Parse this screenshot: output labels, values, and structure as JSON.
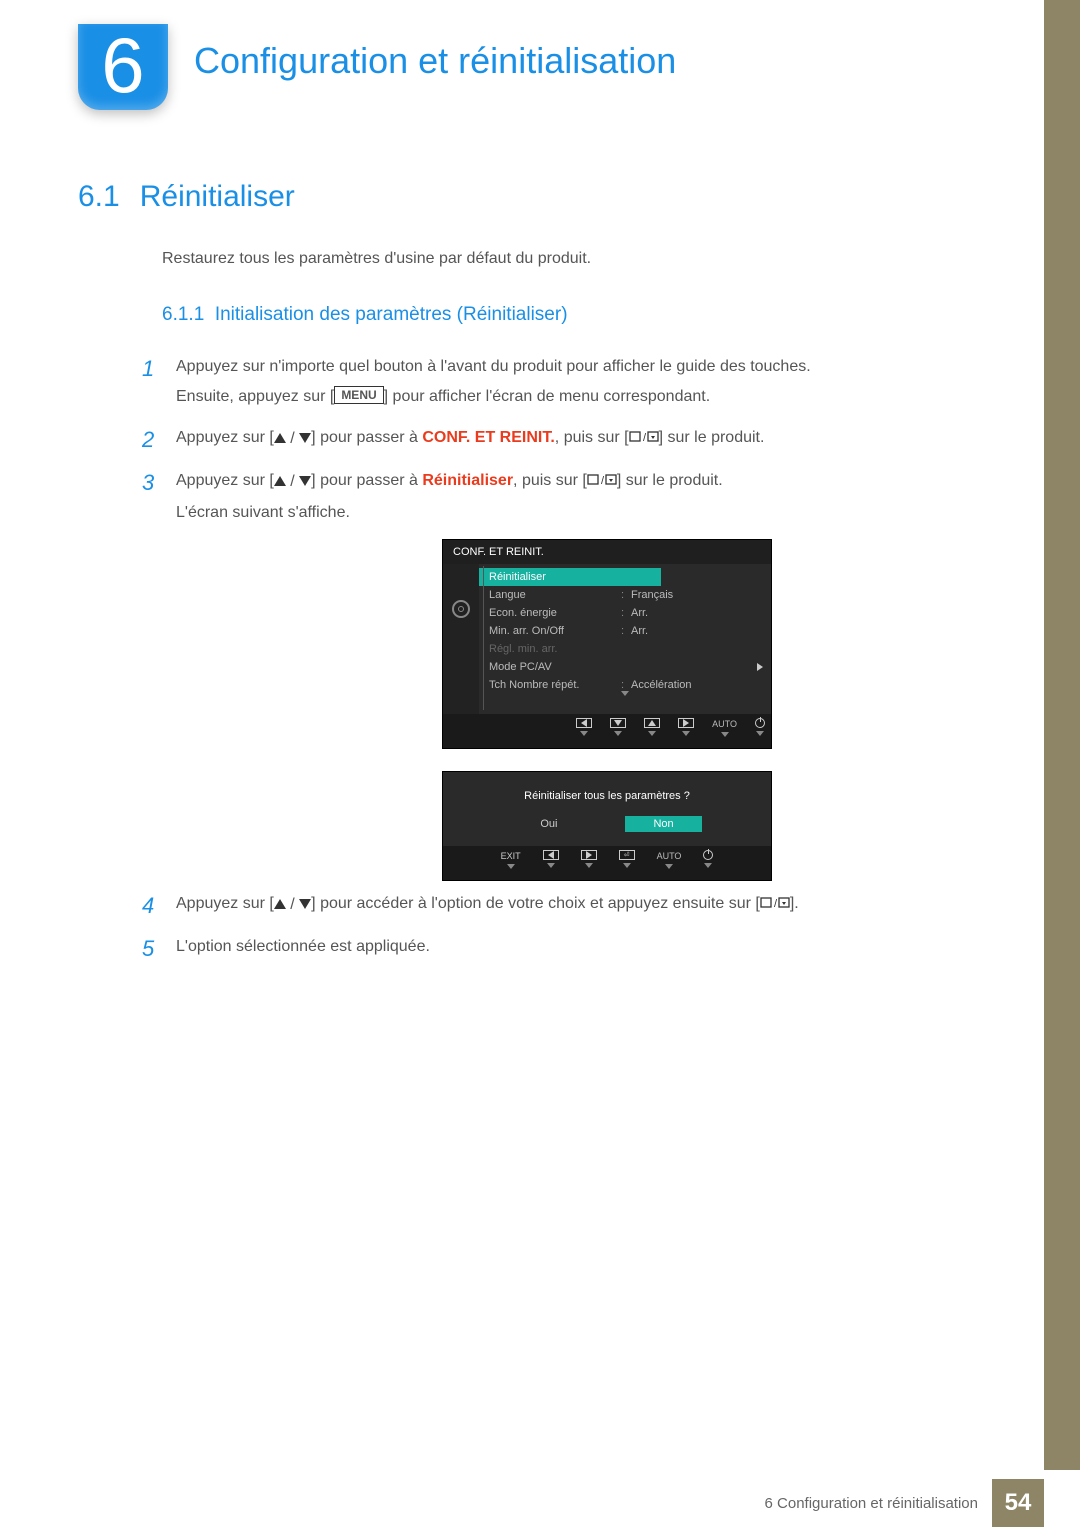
{
  "chapter": {
    "number": "6",
    "title": "Configuration et réinitialisation"
  },
  "section": {
    "number": "6.1",
    "title": "Réinitialiser"
  },
  "intro": "Restaurez tous les paramètres d'usine par défaut du produit.",
  "subsection": {
    "number": "6.1.1",
    "title": "Initialisation des paramètres (Réinitialiser)"
  },
  "steps": {
    "s1a": "Appuyez sur n'importe quel bouton à l'avant du produit pour afficher le guide des touches.",
    "s1b_a": "Ensuite, appuyez sur [",
    "s1b_menu": "MENU",
    "s1b_b": "] pour afficher l'écran de menu correspondant.",
    "s2_a": "Appuyez sur [",
    "s2_b": "] pour passer à ",
    "s2_hl": "CONF. ET REINIT.",
    "s2_c": ", puis sur [",
    "s2_d": "] sur le produit.",
    "s3_a": "Appuyez sur [",
    "s3_b": "] pour passer à ",
    "s3_hl": "Réinitialiser",
    "s3_c": ", puis sur [",
    "s3_d": "] sur le produit.",
    "s3_e": "L'écran suivant s'affiche.",
    "s4_a": "Appuyez sur [",
    "s4_b": "] pour accéder à l'option de votre choix et appuyez ensuite sur [",
    "s4_c": "].",
    "s5": "L'option sélectionnée est appliquée."
  },
  "osd_menu": {
    "title": "CONF. ET REINIT.",
    "rows": [
      {
        "label": "Réinitialiser",
        "value": "",
        "sel": true
      },
      {
        "label": "Langue",
        "value": "Français"
      },
      {
        "label": "Econ. énergie",
        "value": "Arr."
      },
      {
        "label": "Min. arr. On/Off",
        "value": "Arr."
      },
      {
        "label": "Régl. min. arr.",
        "value": "",
        "dim": true
      },
      {
        "label": "Mode PC/AV",
        "value": "",
        "arrow": true
      },
      {
        "label": "Tch Nombre répét.",
        "value": "Accélération"
      }
    ],
    "nav_auto": "AUTO"
  },
  "osd_confirm": {
    "question": "Réinitialiser tous les paramètres ?",
    "yes": "Oui",
    "no": "Non",
    "exit": "EXIT",
    "auto": "AUTO"
  },
  "footer": {
    "label": "6 Configuration et réinitialisation",
    "page": "54"
  }
}
